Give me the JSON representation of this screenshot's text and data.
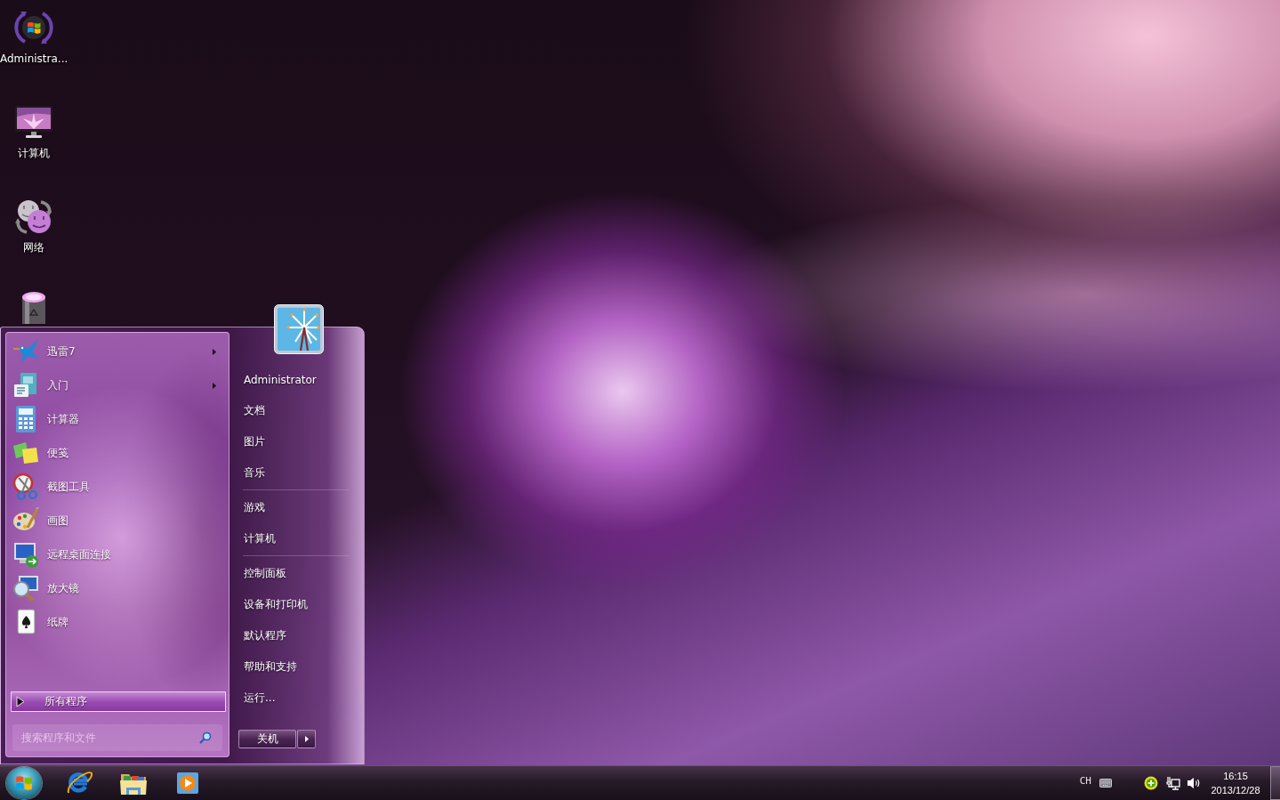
{
  "desktop": {
    "shortcuts": [
      {
        "kind": "user_folder",
        "label": "Administra..."
      },
      {
        "kind": "computer",
        "label": "计算机"
      },
      {
        "kind": "network",
        "label": "网络"
      },
      {
        "kind": "recycle_bin"
      }
    ]
  },
  "start_menu": {
    "programs": [
      {
        "kind": "thunder",
        "label": "迅雷7",
        "has_submenu": true
      },
      {
        "kind": "getting_started",
        "label": "入门",
        "has_submenu": true
      },
      {
        "kind": "calculator",
        "label": "计算器",
        "has_submenu": false
      },
      {
        "kind": "sticky_notes",
        "label": "便笺",
        "has_submenu": false
      },
      {
        "kind": "snipping_tool",
        "label": "截图工具",
        "has_submenu": false
      },
      {
        "kind": "paint",
        "label": "画图",
        "has_submenu": false
      },
      {
        "kind": "remote_desktop",
        "label": "远程桌面连接",
        "has_submenu": false
      },
      {
        "kind": "magnifier",
        "label": "放大镜",
        "has_submenu": false
      },
      {
        "kind": "solitaire",
        "label": "纸牌",
        "has_submenu": false
      }
    ],
    "all_programs": "所有程序",
    "search": {
      "placeholder": "搜索程序和文件"
    },
    "place_groups": [
      {
        "items": [
          "Administrator",
          "文档",
          "图片",
          "音乐"
        ]
      },
      {
        "items": [
          "游戏",
          "计算机"
        ]
      },
      {
        "items": [
          "控制面板",
          "设备和打印机",
          "默认程序",
          "帮助和支持",
          "运行..."
        ]
      }
    ],
    "shutdown": {
      "label": "关机"
    }
  },
  "taskbar": {
    "pinned": [
      {
        "kind": "browser"
      },
      {
        "kind": "file_explorer"
      },
      {
        "kind": "media_player"
      }
    ],
    "tray": {
      "language": "CH",
      "icons": [
        {
          "kind": "keyboard"
        },
        {
          "kind": "security"
        },
        {
          "kind": "network"
        },
        {
          "kind": "volume"
        }
      ]
    },
    "clock": {
      "time": "16:15",
      "date": "2013/12/28"
    }
  }
}
